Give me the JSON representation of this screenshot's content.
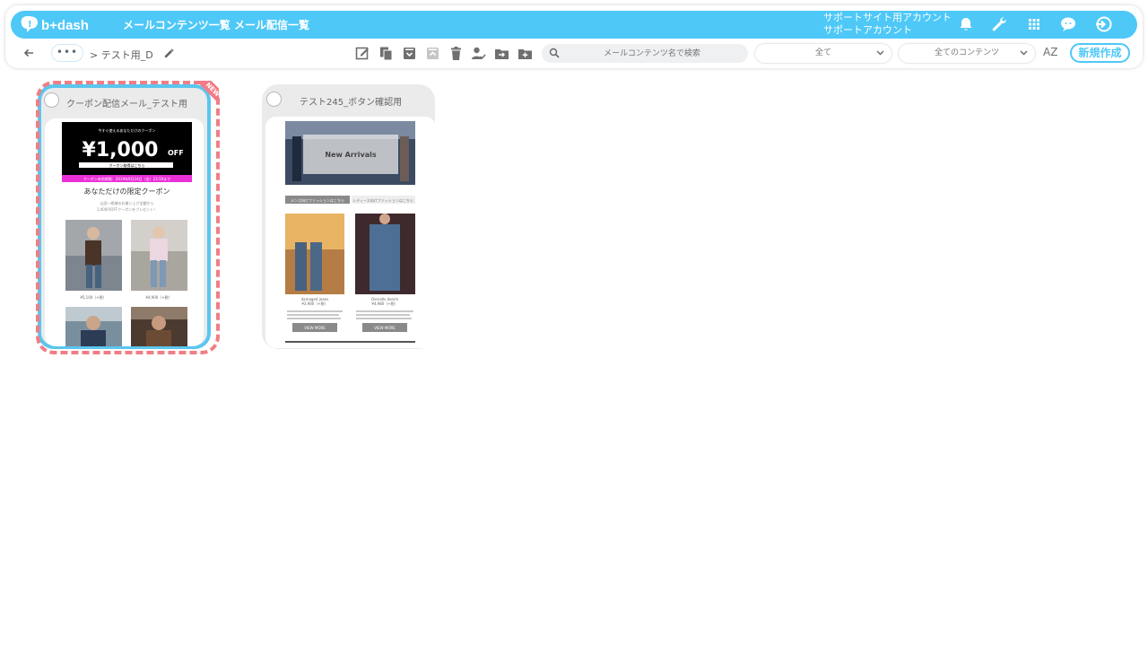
{
  "header": {
    "logo_text": "b+dash",
    "nav": [
      "メールコンテンツ一覧",
      "メール配信一覧"
    ],
    "account_line1": "サポートサイト用アカウント",
    "account_line2": "サポートアカウント",
    "icons": [
      "bell-icon",
      "wrench-icon",
      "apps-icon",
      "chat-bot-icon",
      "logout-icon"
    ]
  },
  "toolbar": {
    "more": "•••",
    "breadcrumb": "> テスト用_D",
    "search_placeholder": "メールコンテンツ名で検索",
    "filter_status": "全て",
    "filter_content": "全てのコンテンツ",
    "sort_label": "AZ",
    "new_button": "新規作成",
    "icons": [
      "compose-icon",
      "copy-icon",
      "archive-icon",
      "unarchive-icon",
      "trash-icon",
      "assign-user-icon",
      "move-folder-icon",
      "new-folder-icon"
    ]
  },
  "cards": [
    {
      "title": "クーポン配信メール_テスト用",
      "badge": "NEW",
      "preview": {
        "heading_small": "今すぐ使えるあなただけのクーポン",
        "amount": "¥1,000",
        "amount_suffix": "OFF",
        "button_text": "クーポン取得はこちら",
        "deadline": "クーポン有効期限：2019年9月24日（金）23:59まで",
        "subtitle": "あなただけの限定クーポン",
        "desc1": "山田一郎様のお買い上げ全額から",
        "desc2": "1,000円OFFクーポンをプレゼント！",
        "price1": "¥5,100（+税）",
        "price2": "¥4,900（+税）"
      }
    },
    {
      "title": "テスト245_ボタン確認用",
      "preview": {
        "hero_text": "New Arrivals",
        "tab1": "メンズ向けファッションはこちら",
        "tab2": "レディース向けファッションはこちら",
        "item1": "damaged jeans",
        "item1_price": "¥3,980（+税）",
        "item2": "Overalls denim",
        "item2_price": "¥4,980（+税）",
        "view_more": "VIEW MORE"
      }
    }
  ]
}
